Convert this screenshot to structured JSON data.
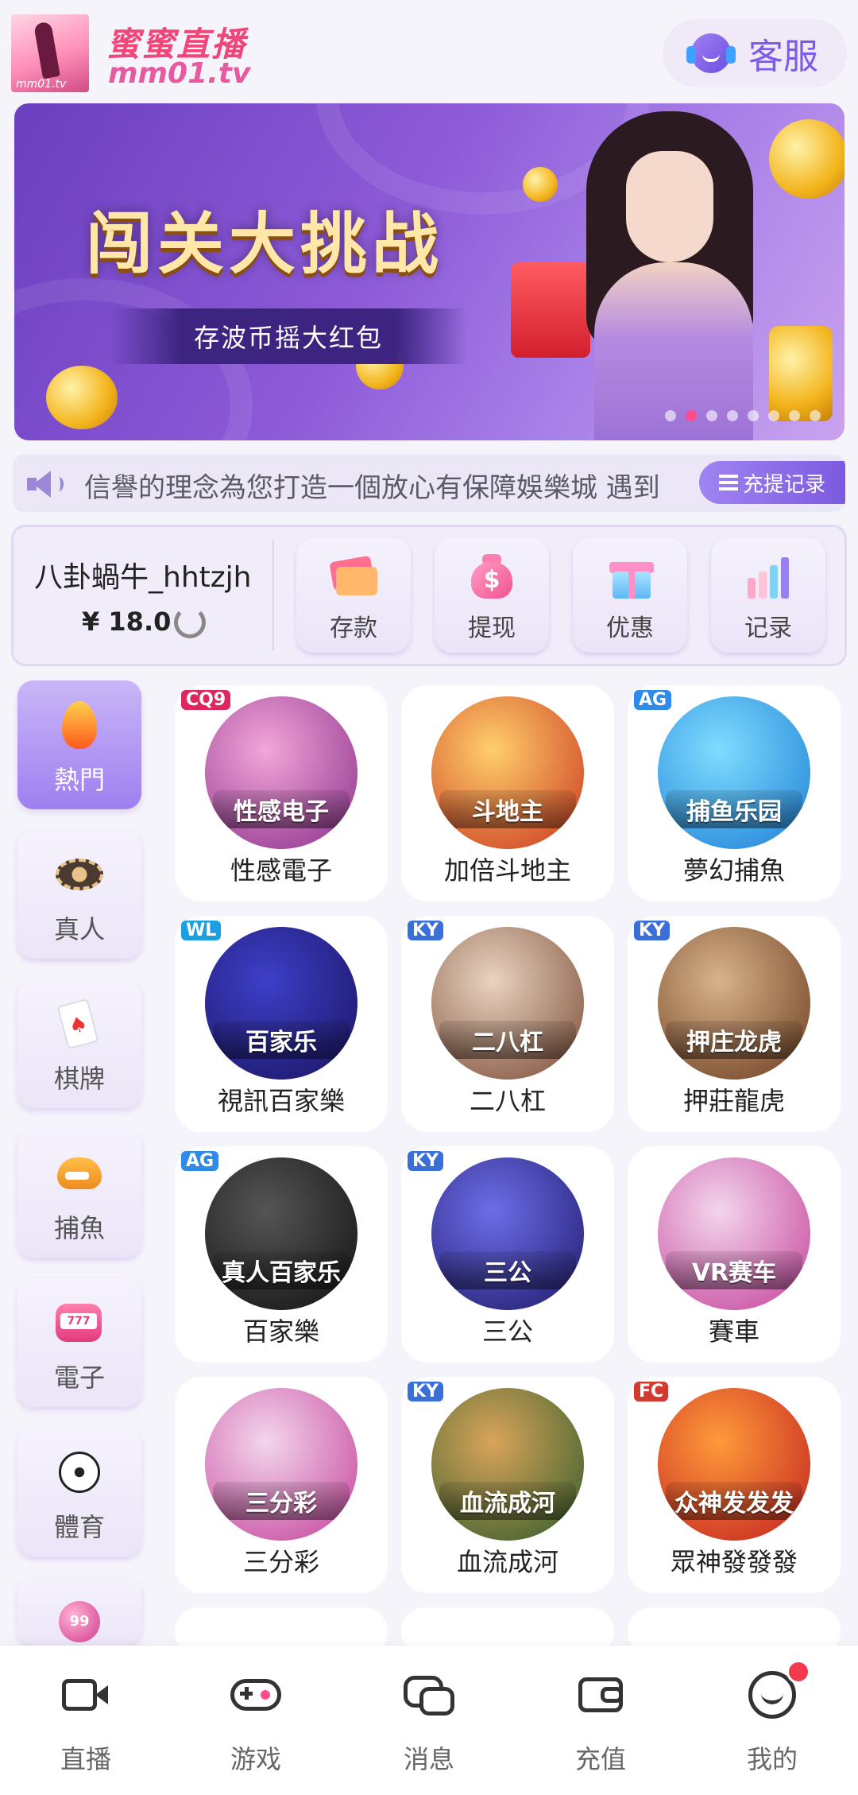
{
  "header": {
    "logo_title": "蜜蜜直播",
    "logo_domain": "mm01.tv",
    "logo_tiny": "mm01.tv",
    "service_label": "客服"
  },
  "banner": {
    "title": "闯关大挑战",
    "subtitle": "存波币摇大红包",
    "dot_count": 8,
    "active_dot": 1
  },
  "marquee": {
    "text": "信譽的理念為您打造一個放心有保障娛樂城  遇到",
    "record_button": "充提记录"
  },
  "wallet": {
    "username": "八卦蝸牛_hhtzjh",
    "balance": "¥ 18.0",
    "actions": [
      {
        "label": "存款",
        "icon": "card-icon"
      },
      {
        "label": "提现",
        "icon": "money-bag-icon"
      },
      {
        "label": "优惠",
        "icon": "gift-icon"
      },
      {
        "label": "记录",
        "icon": "bar-chart-icon"
      }
    ]
  },
  "categories": [
    {
      "label": "熱門",
      "icon": "fire-icon",
      "active": true
    },
    {
      "label": "真人",
      "icon": "chip-icon",
      "active": false
    },
    {
      "label": "棋牌",
      "icon": "playing-card-icon",
      "active": false
    },
    {
      "label": "捕魚",
      "icon": "shark-icon",
      "active": false
    },
    {
      "label": "電子",
      "icon": "slot-machine-icon",
      "active": false
    },
    {
      "label": "體育",
      "icon": "soccer-ball-icon",
      "active": false
    },
    {
      "label": "",
      "icon": "lottery-ball-icon",
      "active": false
    }
  ],
  "games": [
    {
      "label": "性感電子",
      "art_text": "性感电子",
      "tag": "CQ9",
      "colors": [
        "#f2a6d8",
        "#8b2f8c"
      ]
    },
    {
      "label": "加倍斗地主",
      "art_text": "斗地主",
      "tag": "",
      "colors": [
        "#ffcf6b",
        "#c9351e"
      ]
    },
    {
      "label": "夢幻捕魚",
      "art_text": "捕鱼乐园",
      "tag": "AG",
      "colors": [
        "#7fdcff",
        "#1d7fd6"
      ]
    },
    {
      "label": "視訊百家樂",
      "art_text": "百家乐",
      "tag": "WL",
      "colors": [
        "#3d3fc9",
        "#1a1460"
      ]
    },
    {
      "label": "二八杠",
      "art_text": "二八杠",
      "tag": "KY",
      "colors": [
        "#e9d3c0",
        "#7a4a34"
      ]
    },
    {
      "label": "押莊龍虎",
      "art_text": "押庄龙虎",
      "tag": "KY",
      "colors": [
        "#d8b38a",
        "#6a3b1f"
      ]
    },
    {
      "label": "百家樂",
      "art_text": "真人百家乐",
      "tag": "AG",
      "colors": [
        "#555555",
        "#111111"
      ]
    },
    {
      "label": "三公",
      "art_text": "三公",
      "tag": "KY",
      "colors": [
        "#6d6de8",
        "#1e1a6b"
      ]
    },
    {
      "label": "賽車",
      "art_text": "VR赛车",
      "tag": "",
      "colors": [
        "#f3d6ec",
        "#c4409a"
      ]
    },
    {
      "label": "三分彩",
      "art_text": "三分彩",
      "tag": "",
      "colors": [
        "#f3d6ec",
        "#c4409a"
      ]
    },
    {
      "label": "血流成河",
      "art_text": "血流成河",
      "tag": "KY",
      "colors": [
        "#d9a45a",
        "#2f5b2a"
      ]
    },
    {
      "label": "眾神發發發",
      "art_text": "众神发发发",
      "tag": "FC",
      "colors": [
        "#ff9a3a",
        "#c21f1f"
      ]
    }
  ],
  "bottom_nav": [
    {
      "label": "直播",
      "icon": "camera-icon"
    },
    {
      "label": "游戏",
      "icon": "gamepad-icon"
    },
    {
      "label": "消息",
      "icon": "chat-bubble-icon"
    },
    {
      "label": "充值",
      "icon": "wallet-icon"
    },
    {
      "label": "我的",
      "icon": "smile-profile-icon"
    }
  ]
}
